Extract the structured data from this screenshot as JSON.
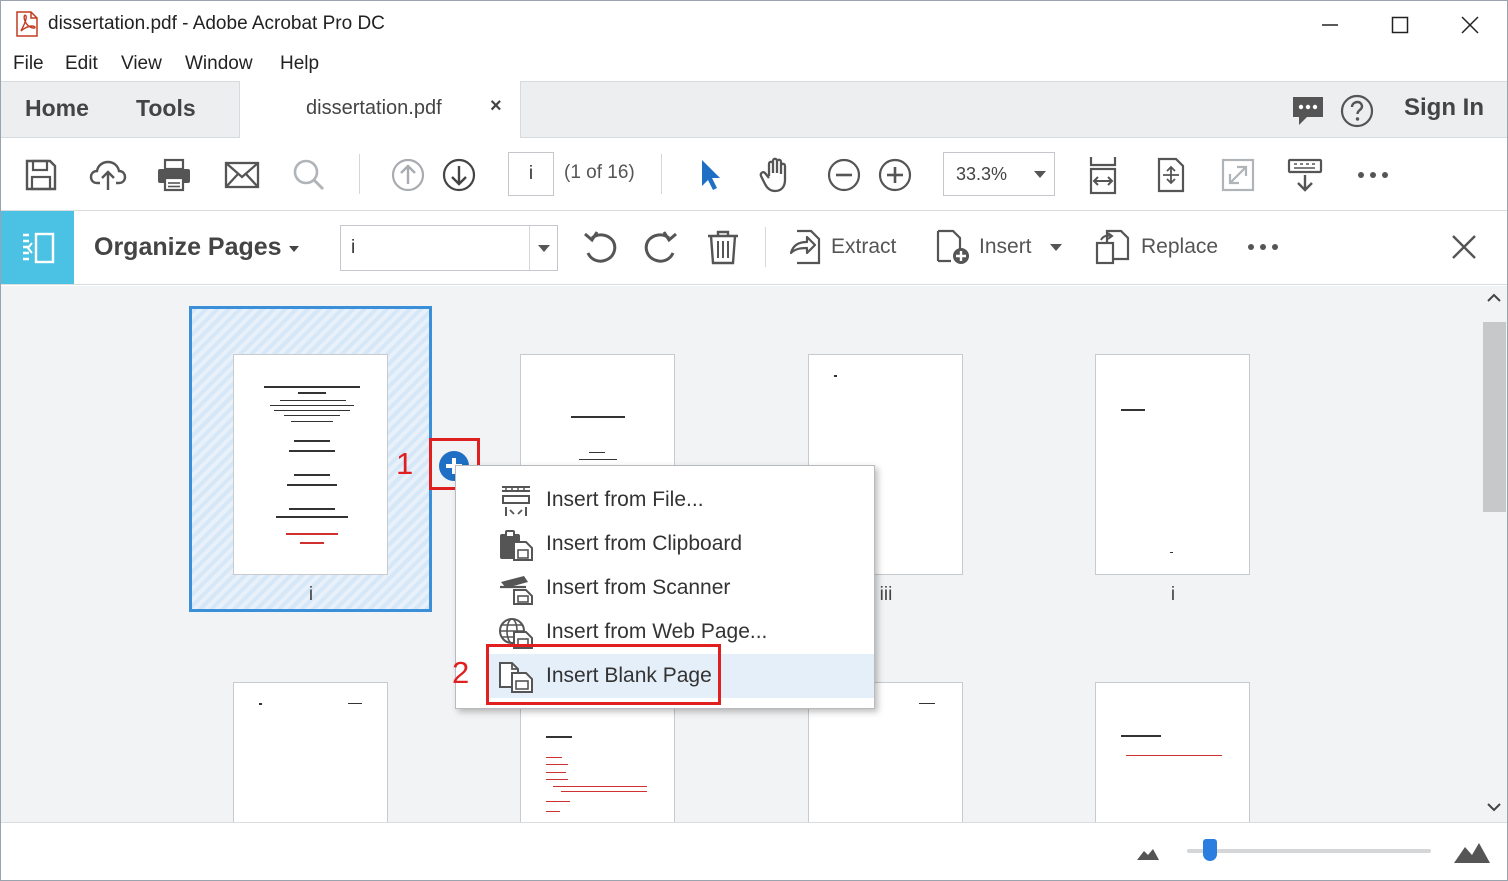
{
  "window": {
    "title": "dissertation.pdf - Adobe Acrobat Pro DC"
  },
  "menu": [
    "File",
    "Edit",
    "View",
    "Window",
    "Help"
  ],
  "tabs": {
    "home": "Home",
    "tools": "Tools",
    "document": "dissertation.pdf",
    "close": "×",
    "sign_in": "Sign In"
  },
  "toolbar": {
    "page_input": "i",
    "page_count": "(1 of 16)",
    "zoom": "33.3%"
  },
  "organize": {
    "title": "Organize Pages",
    "page_range": "i",
    "extract": "Extract",
    "insert": "Insert",
    "replace": "Replace"
  },
  "thumbnails": [
    {
      "label": "i",
      "selected": true
    },
    {
      "label": "",
      "selected": false
    },
    {
      "label": "iii",
      "selected": false
    },
    {
      "label": "i",
      "selected": false
    }
  ],
  "insert_menu": [
    {
      "text": "Insert from File...",
      "icon": "insert-file-icon"
    },
    {
      "text": "Insert from Clipboard",
      "icon": "insert-clipboard-icon"
    },
    {
      "text": "Insert from Scanner",
      "icon": "insert-scanner-icon"
    },
    {
      "text": "Insert from Web Page...",
      "icon": "insert-web-page-icon"
    },
    {
      "text": "Insert Blank Page",
      "icon": "insert-blank-page-icon",
      "highlighted": true
    }
  ],
  "annotations": {
    "step1": "1",
    "step2": "2"
  },
  "colors": {
    "accent": "#4bc2e3",
    "selection": "#3a8fd8",
    "annotation": "#e02020",
    "slider": "#2b7de0"
  },
  "zoom_slider": {
    "level": 0.1
  }
}
